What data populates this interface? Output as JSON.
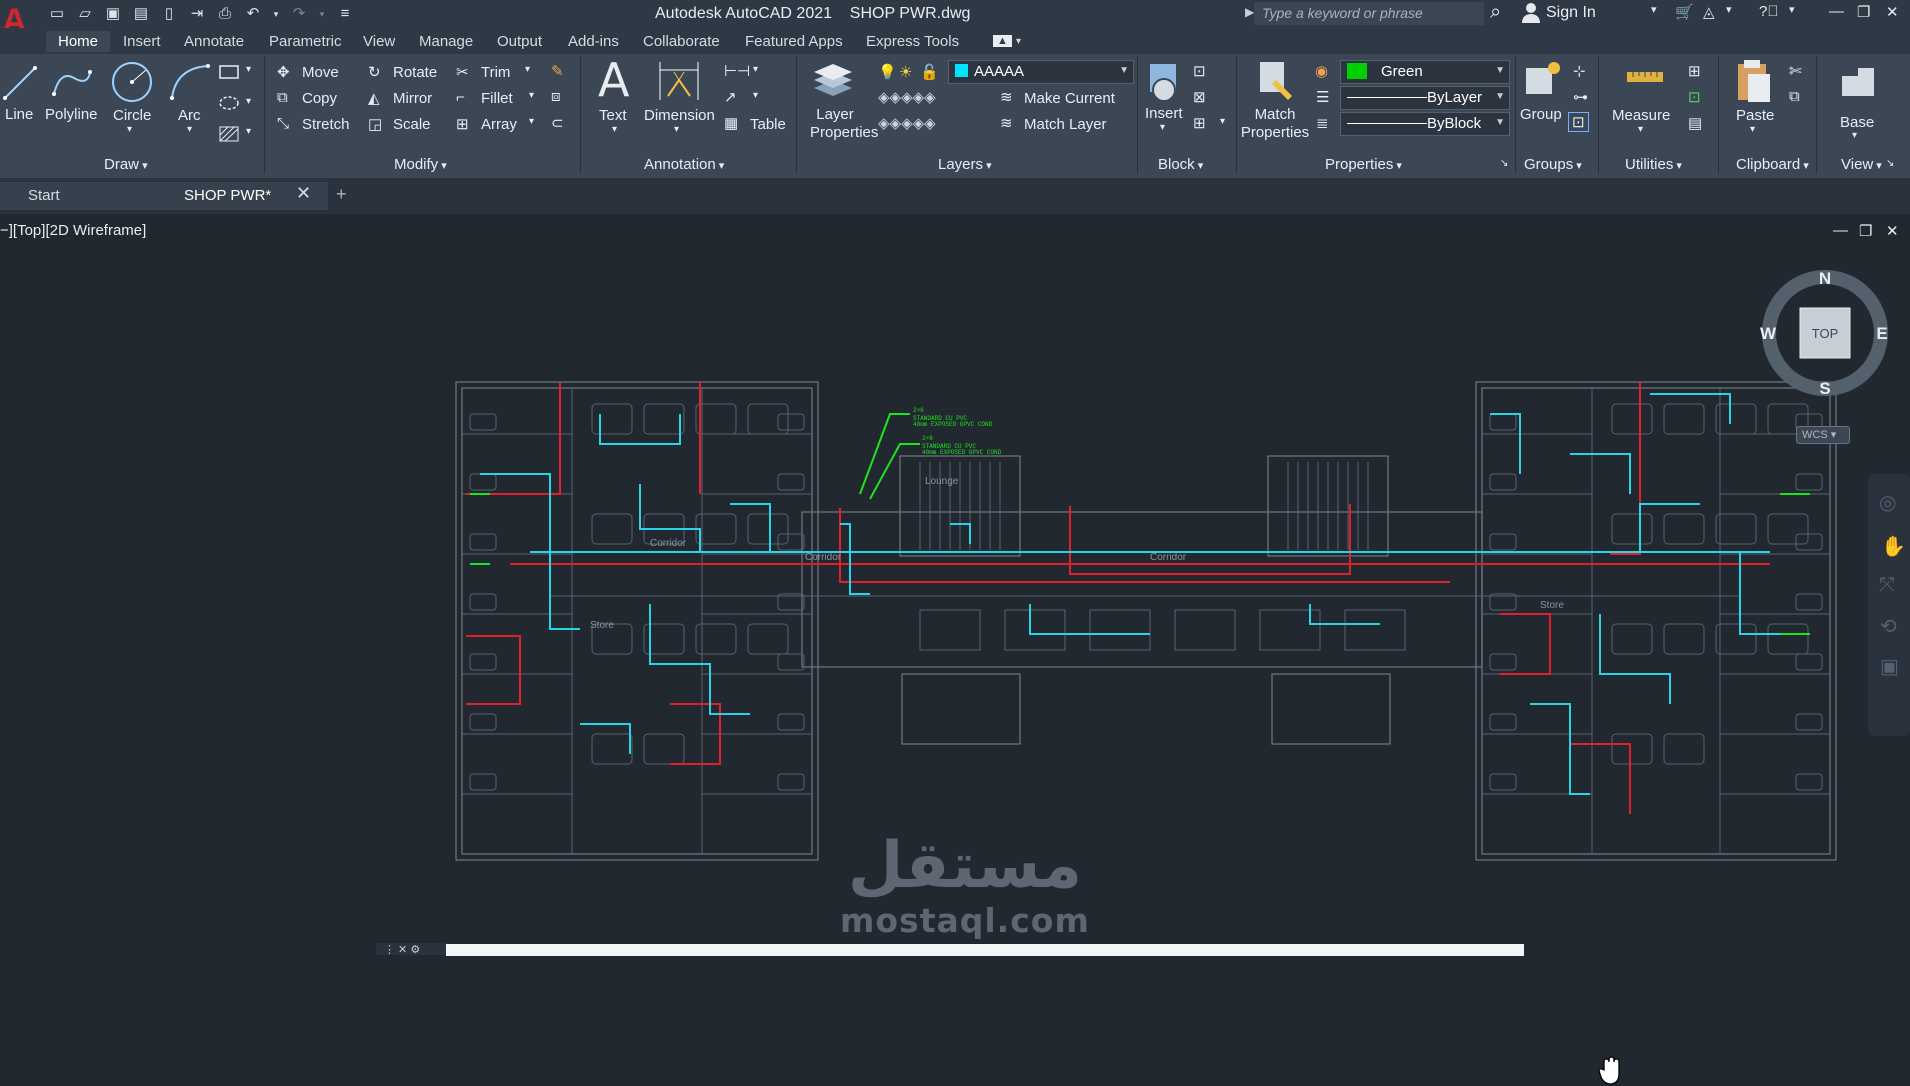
{
  "titlebar": {
    "app_title": "Autodesk AutoCAD 2021",
    "file_title": "SHOP PWR.dwg",
    "search_placeholder": "Type a keyword or phrase",
    "sign_in": "Sign In"
  },
  "menu": {
    "tabs": [
      "Home",
      "Insert",
      "Annotate",
      "Parametric",
      "View",
      "Manage",
      "Output",
      "Add-ins",
      "Collaborate",
      "Featured Apps",
      "Express Tools"
    ]
  },
  "ribbon": {
    "draw": {
      "line": "Line",
      "polyline": "Polyline",
      "circle": "Circle",
      "arc": "Arc",
      "title": "Draw"
    },
    "modify": {
      "move": "Move",
      "rotate": "Rotate",
      "trim": "Trim",
      "copy": "Copy",
      "mirror": "Mirror",
      "fillet": "Fillet",
      "stretch": "Stretch",
      "scale": "Scale",
      "array": "Array",
      "title": "Modify"
    },
    "annotation": {
      "text": "Text",
      "dimension": "Dimension",
      "table": "Table",
      "title": "Annotation"
    },
    "layers": {
      "layer_properties_1": "Layer",
      "layer_properties_2": "Properties",
      "layer_name": "AAAAA",
      "make_current": "Make Current",
      "match_layer": "Match Layer",
      "title": "Layers",
      "layer_color": "#00e5ff"
    },
    "block": {
      "insert": "Insert",
      "title": "Block"
    },
    "properties": {
      "match_1": "Match",
      "match_2": "Properties",
      "color": "Green",
      "color_swatch": "#00d000",
      "linetype": "ByLayer",
      "lineweight": "ByBlock",
      "title": "Properties"
    },
    "groups": {
      "group": "Group",
      "title": "Groups"
    },
    "utilities": {
      "measure": "Measure",
      "title": "Utilities"
    },
    "clipboard": {
      "paste": "Paste",
      "title": "Clipboard"
    },
    "view": {
      "base": "Base",
      "title": "View"
    }
  },
  "doctabs": {
    "start": "Start",
    "active": "SHOP PWR*"
  },
  "viewport": {
    "label": "−][Top][2D Wireframe]",
    "viewcube": {
      "north": "N",
      "south": "S",
      "east": "E",
      "west": "W",
      "top": "TOP",
      "wcs": "WCS"
    }
  },
  "drawing": {
    "room_labels": [
      "Corridor",
      "Corridor",
      "Corridor",
      "Store",
      "Store",
      "Lounge"
    ],
    "note_lines": [
      "2×6",
      "STANDARD CU PVC",
      "40mm EXPOSED GPVC COND",
      "2×6",
      "STANDARD CU PVC",
      "40mm EXPOSED GPVC COND"
    ]
  },
  "watermark": {
    "arabic": "مستقل",
    "latin": "mostaql.com"
  },
  "colors": {
    "wall": "#6f7883",
    "circuit_cyan": "#27d4e8",
    "circuit_red": "#e0202a",
    "circuit_green": "#1fe21f",
    "accent_logo": "#d0272e"
  }
}
